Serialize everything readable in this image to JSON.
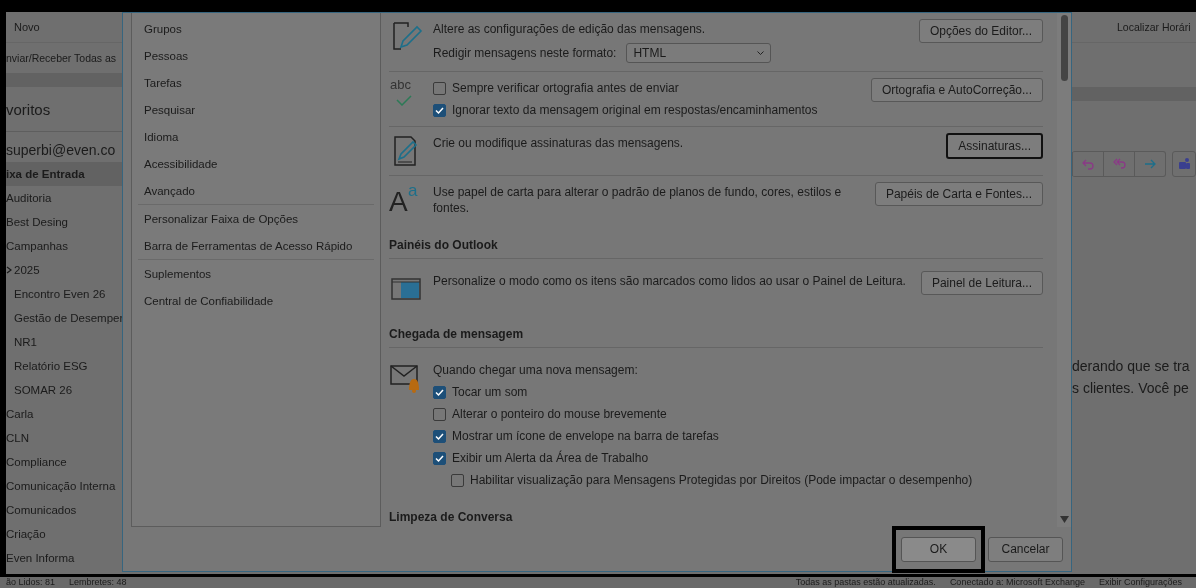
{
  "background": {
    "ribbon": {
      "tab": "Novo",
      "command": "nviar/Receber Todas as",
      "right_command": "Localizar Horári"
    },
    "folder_pane": {
      "header": "voritos",
      "account": "superbi@even.co",
      "folders": [
        {
          "label": "ixa de Entrada",
          "selected": true
        },
        {
          "label": "Auditoria",
          "selected": false
        },
        {
          "label": "Best Desing",
          "selected": false
        },
        {
          "label": "Campanhas",
          "selected": false
        },
        {
          "label": "2025",
          "selected": false,
          "expanded": true,
          "children": [
            {
              "label": "Encontro Even 26",
              "selected": false
            },
            {
              "label": "Gestão de Desemper",
              "selected": false
            },
            {
              "label": "NR1",
              "selected": false
            },
            {
              "label": "Relatório ESG",
              "selected": false
            },
            {
              "label": "SOMAR 26",
              "selected": false
            }
          ]
        },
        {
          "label": "Carla",
          "selected": false
        },
        {
          "label": "CLN",
          "selected": false
        },
        {
          "label": "Compliance",
          "selected": false
        },
        {
          "label": "Comunicação Interna",
          "selected": false
        },
        {
          "label": "Comunicados",
          "selected": false
        },
        {
          "label": "Criação",
          "selected": false
        },
        {
          "label": "Even Informa",
          "selected": false
        }
      ]
    },
    "reading_pane": {
      "lines": [
        "derando que se tra",
        "s clientes. Você pe"
      ]
    },
    "status_bar": {
      "left": [
        "ão Lidos: 81",
        "Lembretes: 48"
      ],
      "right": [
        "Todas as pastas estão atualizadas.",
        "Conectado a: Microsoft Exchange",
        "Exibir Configurações"
      ]
    }
  },
  "options_dialog": {
    "nav": [
      {
        "items": [
          {
            "label": "Grupos"
          },
          {
            "label": "Pessoas"
          },
          {
            "label": "Tarefas"
          },
          {
            "label": "Pesquisar"
          },
          {
            "label": "Idioma"
          },
          {
            "label": "Acessibilidade"
          },
          {
            "label": "Avançado"
          }
        ]
      },
      {
        "items": [
          {
            "label": "Personalizar Faixa de Opções"
          },
          {
            "label": "Barra de Ferramentas de Acesso Rápido"
          }
        ]
      },
      {
        "items": [
          {
            "label": "Suplementos"
          },
          {
            "label": "Central de Confiabilidade"
          }
        ]
      }
    ],
    "content": [
      {
        "kind": "block",
        "items": [
          {
            "kind": "text",
            "text": "Altere as configurações de edição das mensagens."
          },
          {
            "kind": "select",
            "label": "Redigir mensagens neste formato:",
            "value": "HTML"
          }
        ],
        "button": {
          "label": "Opções do Editor...",
          "focused": false
        }
      },
      {
        "kind": "block",
        "icon_text": [
          "abc"
        ],
        "items": [
          {
            "kind": "checkbox",
            "label": "Sempre verificar ortografia antes de enviar",
            "checked": false
          },
          {
            "kind": "checkbox",
            "label": "Ignorar texto da mensagem original em respostas/encaminhamentos",
            "checked": true
          }
        ],
        "button": {
          "label": "Ortografia e AutoCorreção...",
          "focused": false
        }
      },
      {
        "kind": "block",
        "items": [
          {
            "kind": "text",
            "text": "Crie ou modifique assinaturas das mensagens."
          }
        ],
        "button": {
          "label": "Assinaturas...",
          "focused": true
        }
      },
      {
        "kind": "block",
        "icon_text": [
          "A",
          "a"
        ],
        "items": [
          {
            "kind": "text",
            "text": "Use papel de carta para alterar o padrão de planos de fundo, cores, estilos e fontes."
          }
        ],
        "button": {
          "label": "Papéis de Carta e Fontes...",
          "focused": false
        }
      },
      {
        "kind": "heading",
        "text": "Painéis do Outlook"
      },
      {
        "kind": "block",
        "items": [
          {
            "kind": "text",
            "text": "Personalize o modo como os itens são marcados como lidos ao usar o Painel de Leitura."
          }
        ],
        "button": {
          "label": "Painel de Leitura...",
          "focused": false
        }
      },
      {
        "kind": "heading",
        "text": "Chegada de mensagem"
      },
      {
        "kind": "block",
        "items": [
          {
            "kind": "text",
            "text": "Quando chegar uma nova mensagem:"
          },
          {
            "kind": "checkbox",
            "label": "Tocar um som",
            "checked": true
          },
          {
            "kind": "checkbox",
            "label": "Alterar o ponteiro do mouse brevemente",
            "checked": false
          },
          {
            "kind": "checkbox",
            "label": "Mostrar um ícone de envelope na barra de tarefas",
            "checked": true
          },
          {
            "kind": "checkbox",
            "label": "Exibir um Alerta da Área de Trabalho",
            "checked": true,
            "children": [
              {
                "kind": "checkbox",
                "label": "Habilitar visualização para Mensagens Protegidas por Direitos (Pode impactar o desempenho)",
                "checked": false
              }
            ]
          }
        ]
      },
      {
        "kind": "heading",
        "text": "Limpeza de Conversa"
      }
    ],
    "buttons": [
      {
        "label": "OK",
        "highlighted": true
      },
      {
        "label": "Cancelar",
        "highlighted": false
      }
    ]
  }
}
